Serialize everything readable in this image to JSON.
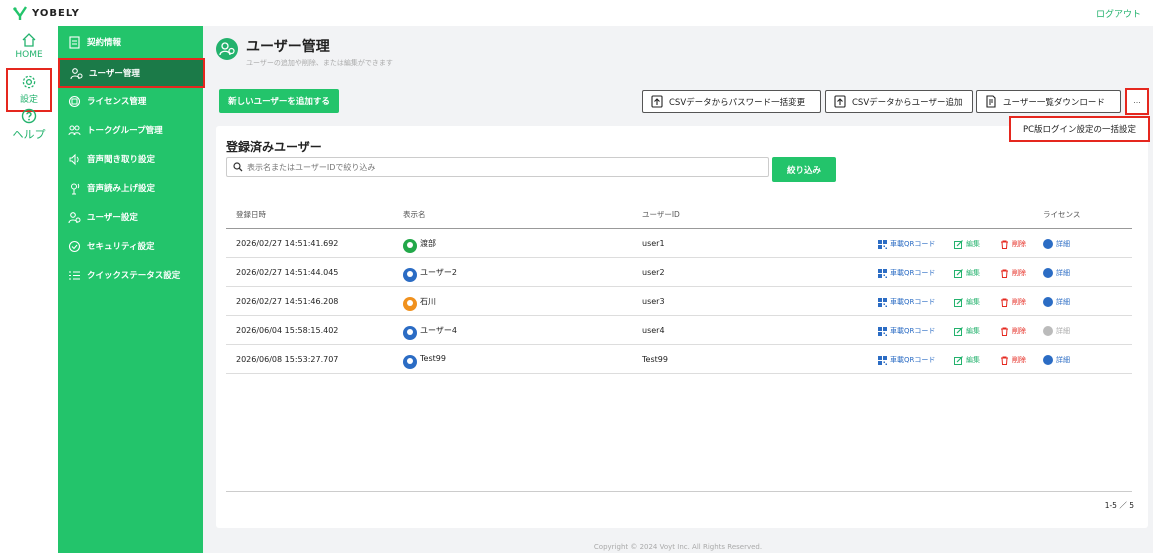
{
  "app": {
    "brand": "YOBELY",
    "logout": "ログアウト"
  },
  "rail": {
    "home": "HOME",
    "settings": "設定",
    "help": "ヘルプ"
  },
  "menu": {
    "items": [
      {
        "label": "契約情報"
      },
      {
        "label": "ユーザー管理"
      },
      {
        "label": "ライセンス管理"
      },
      {
        "label": "トークグループ管理"
      },
      {
        "label": "音声聞き取り設定"
      },
      {
        "label": "音声読み上げ設定"
      },
      {
        "label": "ユーザー設定"
      },
      {
        "label": "セキュリティ設定"
      },
      {
        "label": "クイックステータス設定"
      }
    ]
  },
  "page": {
    "title": "ユーザー管理",
    "subtitle": "ユーザーの追加や削除、または編集ができます"
  },
  "toolbar": {
    "add_user": "新しいユーザーを追加する",
    "csv_password": "CSVデータからパスワード一括変更",
    "csv_add": "CSVデータからユーザー追加",
    "download": "ユーザー一覧ダウンロード",
    "more": "...",
    "dropdown_item": "PC版ログイン設定の一括設定"
  },
  "card": {
    "title": "登録済みユーザー",
    "search_placeholder": "表示名またはユーザーIDで絞り込み",
    "filter_button": "絞り込み"
  },
  "table": {
    "headers": {
      "date": "登録日時",
      "name": "表示名",
      "id": "ユーザーID",
      "license": "ライセンス"
    },
    "actions": {
      "qr": "車載QRコード",
      "edit": "編集",
      "delete": "削除",
      "detail": "詳細"
    },
    "rows": [
      {
        "date": "2026/02/27 14:51:41.692",
        "name": "渡部",
        "id": "user1",
        "avatar_color": "#23a84a",
        "license_active": true
      },
      {
        "date": "2026/02/27 14:51:44.045",
        "name": "ユーザー2",
        "id": "user2",
        "avatar_color": "#2b6cc4",
        "license_active": true
      },
      {
        "date": "2026/02/27 14:51:46.208",
        "name": "石川",
        "id": "user3",
        "avatar_color": "#f0911e",
        "license_active": true
      },
      {
        "date": "2026/06/04 15:58:15.402",
        "name": "ユーザー4",
        "id": "user4",
        "avatar_color": "#2b6cc4",
        "license_active": false
      },
      {
        "date": "2026/06/08 15:53:27.707",
        "name": "Test99",
        "id": "Test99",
        "avatar_color": "#2b6cc4",
        "license_active": true
      }
    ]
  },
  "pagination": "1-5 ／ 5",
  "footer": "Copyright © 2024 Voyt Inc. All Rights Reserved.",
  "colors": {
    "brand_green": "#23c46b",
    "active_menu": "#1b7a48",
    "highlight": "#e5271e",
    "link_blue": "#2b6cc4",
    "delete_red": "#e5271e"
  }
}
